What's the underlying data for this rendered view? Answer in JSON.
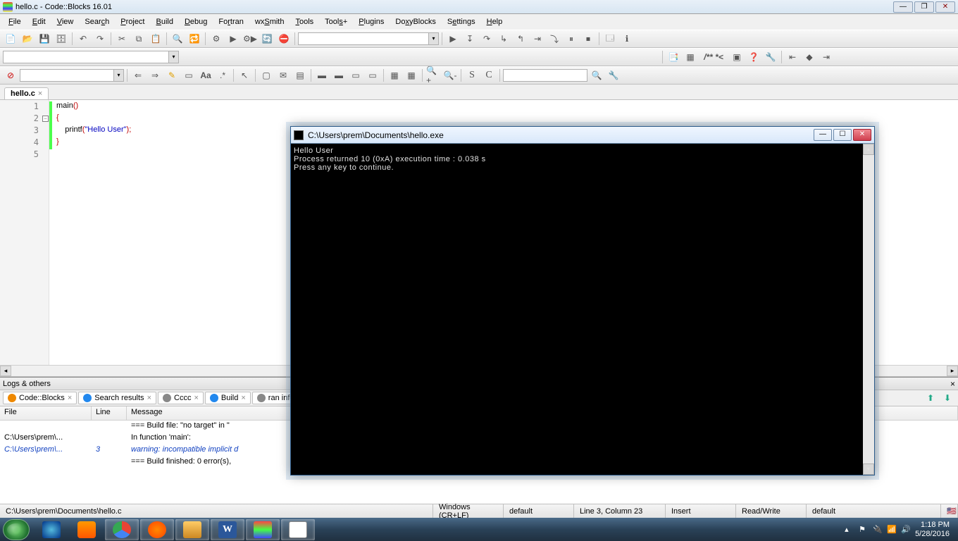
{
  "titlebar": {
    "title": "hello.c - Code::Blocks 16.01"
  },
  "menu": [
    "File",
    "Edit",
    "View",
    "Search",
    "Project",
    "Build",
    "Debug",
    "Fortran",
    "wxSmith",
    "Tools",
    "Tools+",
    "Plugins",
    "DoxyBlocks",
    "Settings",
    "Help"
  ],
  "menuUnderline": [
    0,
    0,
    0,
    4,
    0,
    0,
    0,
    2,
    2,
    0,
    4,
    0,
    2,
    1,
    0
  ],
  "tab": {
    "name": "hello.c"
  },
  "code": {
    "lines": [
      {
        "n": "1",
        "html": "main<span class='paren'>()</span>"
      },
      {
        "n": "2",
        "html": "<span class='brace'>{</span>"
      },
      {
        "n": "3",
        "html": "    printf<span class='paren'>(</span><span class='str'>\"Hello User\"</span><span class='paren'>)</span><span class='semi'>;</span>"
      },
      {
        "n": "4",
        "html": "<span class='brace'>}</span>"
      },
      {
        "n": "5",
        "html": ""
      }
    ]
  },
  "logs": {
    "title": "Logs & others",
    "tabs": [
      "Code::Blocks",
      "Search results",
      "Cccc",
      "Build",
      "ran info"
    ],
    "cols": [
      "File",
      "Line",
      "Message"
    ],
    "rows": [
      {
        "file": "",
        "line": "",
        "msg": "=== Build file: \"no target\" in \""
      },
      {
        "file": "C:\\Users\\prem\\...",
        "line": "",
        "msg": "In function 'main':"
      },
      {
        "file": "C:\\Users\\prem\\...",
        "line": "3",
        "msg": "warning: incompatible implicit d",
        "warn": true
      },
      {
        "file": "",
        "line": "",
        "msg": "=== Build finished: 0 error(s),"
      }
    ]
  },
  "status": {
    "path": "C:\\Users\\prem\\Documents\\hello.c",
    "encoding": "Windows (CR+LF)",
    "mode": "default",
    "pos": "Line 3, Column 23",
    "insert": "Insert",
    "rw": "Read/Write",
    "def2": "default"
  },
  "console": {
    "title": "C:\\Users\\prem\\Documents\\hello.exe",
    "lines": [
      "Hello User",
      "Process returned 10 (0xA)   execution time : 0.038 s",
      "Press any key to continue."
    ]
  },
  "tray": {
    "time": "1:18 PM",
    "date": "5/28/2016"
  }
}
